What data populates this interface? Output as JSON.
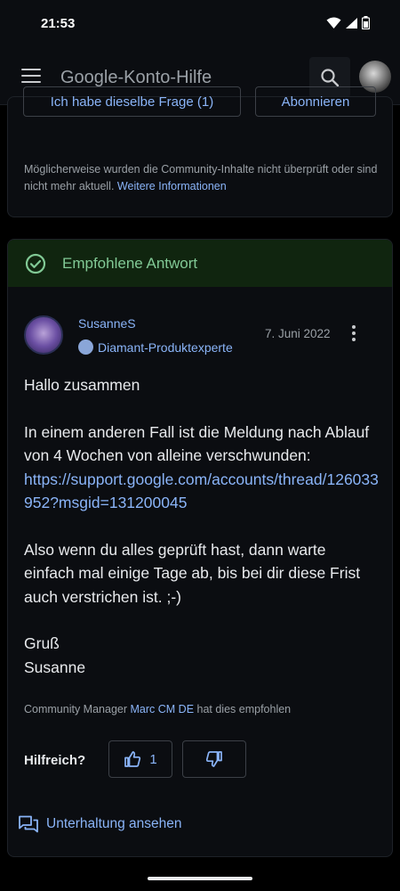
{
  "status_bar": {
    "time": "21:53"
  },
  "app_bar": {
    "title": "Google-Konto-Hilfe"
  },
  "question_card": {
    "same_question_label": "Ich habe dieselbe Frage (1)",
    "subscribe_label": "Abonnieren",
    "disclaimer_text": "Möglicherweise wurden die Community-Inhalte nicht überprüft oder sind nicht mehr aktuell. ",
    "disclaimer_link": "Weitere Informationen"
  },
  "recommended_answer": {
    "header_label": "Empfohlene Antwort",
    "author_name": "SusanneS",
    "author_badge": "Diamant-Produktexperte",
    "date": "7. Juni 2022",
    "greeting": "Hallo zusammen",
    "paragraph1": "In einem anderen Fall ist die Meldung nach Ablauf von 4 Wochen von alleine verschwunden:",
    "link": "https://support.google.com/accounts/thread/126033952?msgid=131200045",
    "paragraph2": "Also wenn du alles geprüft hast, dann warte einfach mal einige Tage ab, bis bei dir diese Frist auch verstrichen ist. ;-)",
    "sign_off": "Gruß",
    "signature": "Susanne",
    "endorse_prefix": "Community Manager ",
    "endorse_manager": "Marc CM DE",
    "endorse_suffix": " hat dies empfohlen",
    "helpful_label": "Hilfreich?",
    "upvote_count": "1",
    "view_conversation_label": "Unterhaltung ansehen"
  },
  "colors": {
    "accent": "#8ab4f8",
    "recommended_green": "#81c995",
    "recommended_bg": "#10250f",
    "card_bg": "#0b0d11"
  },
  "icons": [
    "menu-icon",
    "search-icon",
    "check-circle-icon",
    "badge-icon",
    "more-vert-icon",
    "thumb-up-icon",
    "thumb-down-icon",
    "forum-icon"
  ]
}
